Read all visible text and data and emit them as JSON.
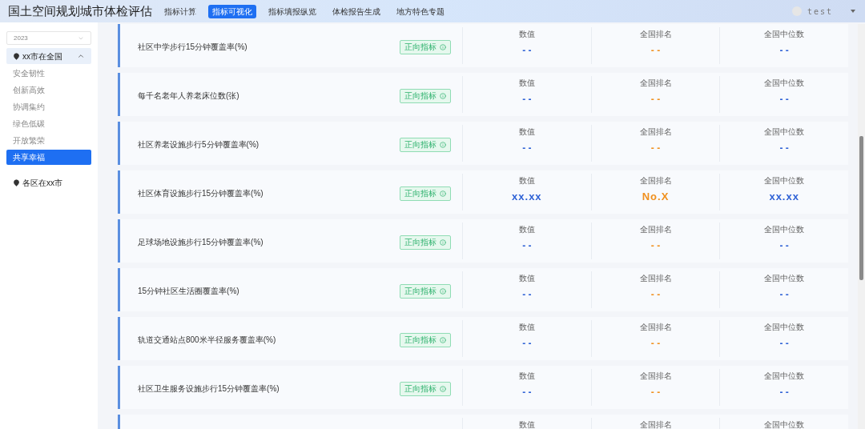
{
  "header": {
    "title": "国土空间规划城市体检评估",
    "tabs": [
      {
        "label": "指标计算",
        "selected": false
      },
      {
        "label": "指标可视化",
        "selected": true
      },
      {
        "label": "指标填报纵览",
        "selected": false
      },
      {
        "label": "体检报告生成",
        "selected": false
      },
      {
        "label": "地方特色专题",
        "selected": false
      }
    ],
    "user": "test"
  },
  "sidebar": {
    "year": "2023",
    "groups": [
      {
        "label": "xx市在全国",
        "expanded": true,
        "items": [
          {
            "label": "安全韧性",
            "selected": false
          },
          {
            "label": "创新高效",
            "selected": false
          },
          {
            "label": "协调集约",
            "selected": false
          },
          {
            "label": "绿色低碳",
            "selected": false
          },
          {
            "label": "开放繁荣",
            "selected": false
          },
          {
            "label": "共享幸福",
            "selected": true
          }
        ]
      },
      {
        "label": "各区在xx市",
        "expanded": false
      }
    ]
  },
  "indicators": [
    {
      "name": "社区中学步行15分钟覆盖率(%)",
      "badge": "正向指标",
      "stats": [
        {
          "kind": "number",
          "label": "数值",
          "value": "- -"
        },
        {
          "kind": "rank",
          "label": "全国排名",
          "value": "- -"
        },
        {
          "kind": "number",
          "label": "全国中位数",
          "value": "- -"
        }
      ]
    },
    {
      "name": "每千名老年人养老床位数(张)",
      "badge": "正向指标",
      "stats": [
        {
          "kind": "number",
          "label": "数值",
          "value": "- -"
        },
        {
          "kind": "rank",
          "label": "全国排名",
          "value": "- -"
        },
        {
          "kind": "number",
          "label": "全国中位数",
          "value": "- -"
        }
      ]
    },
    {
      "name": "社区养老设施步行5分钟覆盖率(%)",
      "badge": "正向指标",
      "stats": [
        {
          "kind": "number",
          "label": "数值",
          "value": "- -"
        },
        {
          "kind": "rank",
          "label": "全国排名",
          "value": "- -"
        },
        {
          "kind": "number",
          "label": "全国中位数",
          "value": "- -"
        }
      ]
    },
    {
      "name": "社区体育设施步行15分钟覆盖率(%)",
      "badge": "正向指标",
      "stats": [
        {
          "kind": "number",
          "label": "数值",
          "value": "xx.xx"
        },
        {
          "kind": "rank",
          "label": "全国排名",
          "value": "No.X"
        },
        {
          "kind": "number",
          "label": "全国中位数",
          "value": "xx.xx"
        }
      ]
    },
    {
      "name": "足球场地设施步行15分钟覆盖率(%)",
      "badge": "正向指标",
      "stats": [
        {
          "kind": "number",
          "label": "数值",
          "value": "- -"
        },
        {
          "kind": "rank",
          "label": "全国排名",
          "value": "- -"
        },
        {
          "kind": "number",
          "label": "全国中位数",
          "value": "- -"
        }
      ]
    },
    {
      "name": "15分钟社区生活圈覆盖率(%)",
      "badge": "正向指标",
      "stats": [
        {
          "kind": "number",
          "label": "数值",
          "value": "- -"
        },
        {
          "kind": "rank",
          "label": "全国排名",
          "value": "- -"
        },
        {
          "kind": "number",
          "label": "全国中位数",
          "value": "- -"
        }
      ]
    },
    {
      "name": "轨道交通站点800米半径服务覆盖率(%)",
      "badge": "正向指标",
      "stats": [
        {
          "kind": "number",
          "label": "数值",
          "value": "- -"
        },
        {
          "kind": "rank",
          "label": "全国排名",
          "value": "- -"
        },
        {
          "kind": "number",
          "label": "全国中位数",
          "value": "- -"
        }
      ]
    },
    {
      "name": "社区卫生服务设施步行15分钟覆盖率(%)",
      "badge": "正向指标",
      "stats": [
        {
          "kind": "number",
          "label": "数值",
          "value": "- -"
        },
        {
          "kind": "rank",
          "label": "全国排名",
          "value": "- -"
        },
        {
          "kind": "number",
          "label": "全国中位数",
          "value": "- -"
        }
      ]
    },
    {
      "stats": [
        {
          "kind": "number",
          "label": "数值"
        },
        {
          "kind": "rank",
          "label": "全国排名"
        },
        {
          "kind": "number",
          "label": "全国中位数"
        }
      ]
    }
  ]
}
